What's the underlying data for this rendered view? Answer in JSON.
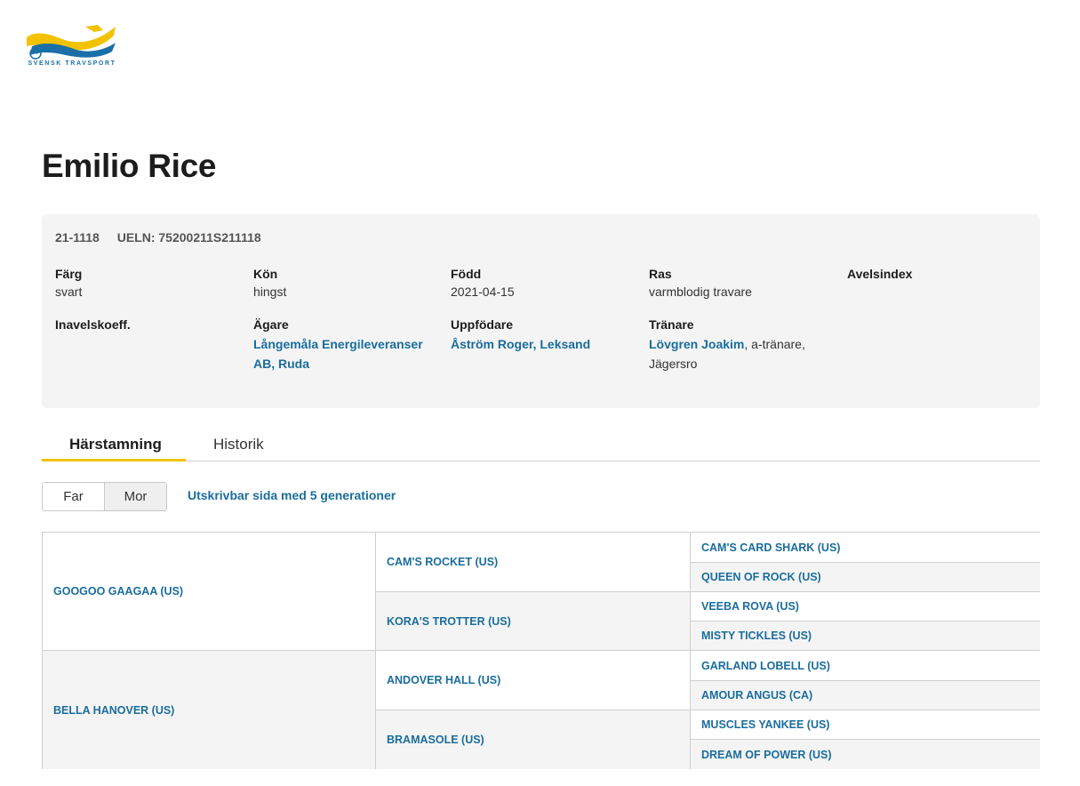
{
  "logo": {
    "text": "SVENSK TRAVSPORT"
  },
  "horse": {
    "name": "Emilio Rice",
    "reg_number": "21-1118",
    "ueln": "UELN: 75200211S211118"
  },
  "fields": {
    "color_label": "Färg",
    "color_value": "svart",
    "sex_label": "Kön",
    "sex_value": "hingst",
    "born_label": "Född",
    "born_value": "2021-04-15",
    "breed_label": "Ras",
    "breed_value": "varmblodig travare",
    "index_label": "Avelsindex",
    "inbreeding_label": "Inavelskoeff.",
    "owner_label": "Ägare",
    "owner_value": "Långemåla Energileveranser AB, Ruda",
    "breeder_label": "Uppfödare",
    "breeder_value": "Åström Roger, Leksand",
    "trainer_label": "Tränare",
    "trainer_name": "Lövgren Joakim",
    "trainer_rest": ", a-tränare, Jägersro"
  },
  "tabs": {
    "pedigree": "Härstamning",
    "history": "Historik"
  },
  "toggle": {
    "far": "Far",
    "mor": "Mor"
  },
  "print_link": "Utskrivbar sida med 5 generationer",
  "pedigree": {
    "gen1": [
      "GOOGOO GAAGAA (US)",
      "BELLA HANOVER (US)"
    ],
    "gen2": [
      "CAM'S ROCKET (US)",
      "KORA'S TROTTER (US)",
      "ANDOVER HALL (US)",
      "BRAMASOLE (US)"
    ],
    "gen3": [
      "CAM'S CARD SHARK (US)",
      "QUEEN OF ROCK (US)",
      "VEEBA ROVA (US)",
      "MISTY TICKLES (US)",
      "GARLAND LOBELL (US)",
      "AMOUR ANGUS (CA)",
      "MUSCLES YANKEE (US)",
      "DREAM OF POWER (US)"
    ]
  },
  "colors": {
    "link": "#1a6d9c",
    "accent": "#f2c200",
    "card_bg": "#f4f4f4"
  }
}
